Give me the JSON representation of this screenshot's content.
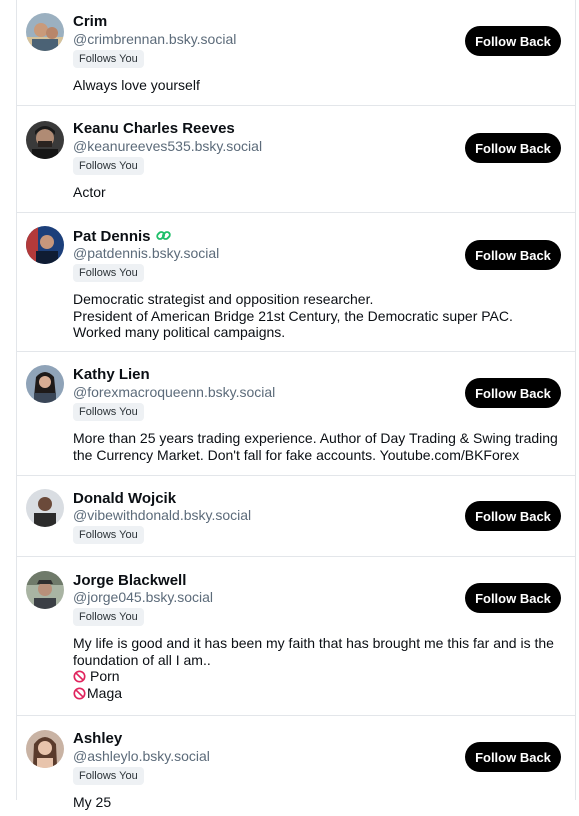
{
  "accent": "#000000",
  "users": [
    {
      "name": "Crim",
      "handle": "@crimbrennan.bsky.social",
      "badge": "Follows You",
      "button": "Follow Back",
      "bio": [
        "Always love yourself"
      ]
    },
    {
      "name": "Keanu Charles Reeves",
      "handle": "@keanureeves535.bsky.social",
      "badge": "Follows You",
      "button": "Follow Back",
      "bio": [
        "Actor"
      ]
    },
    {
      "name": "Pat Dennis",
      "handle": "@patdennis.bsky.social",
      "badge": "Follows You",
      "button": "Follow Back",
      "verified_icon": "verified-link-icon",
      "bio": [
        "Democratic strategist and opposition researcher.",
        "President of American Bridge 21st Century, the Democratic super PAC.",
        "Worked many political campaigns."
      ]
    },
    {
      "name": "Kathy Lien",
      "handle": "@forexmacroqueenn.bsky.social",
      "badge": "Follows You",
      "button": "Follow Back",
      "bio": [
        "More than 25 years trading experience. Author of Day Trading & Swing trading",
        "the Currency Market. Don't fall for fake accounts. Youtube.com/BKForex"
      ]
    },
    {
      "name": "Donald Wojcik",
      "handle": "@vibewithdonald.bsky.social",
      "badge": "Follows You",
      "button": "Follow Back",
      "bio": []
    },
    {
      "name": "Jorge Blackwell",
      "handle": "@jorge045.bsky.social",
      "badge": "Follows You",
      "button": "Follow Back",
      "bio": [
        "My life is good and it has been my faith that has brought me this far and is the",
        "foundation of all I am..",
        "Porn",
        "Maga"
      ],
      "bio_icons": [
        "no-entry-icon",
        "no-entry-icon"
      ]
    },
    {
      "name": "Ashley",
      "handle": "@ashleylo.bsky.social",
      "badge": "Follows You",
      "button": "Follow Back",
      "bio": [
        "My 25"
      ]
    }
  ]
}
